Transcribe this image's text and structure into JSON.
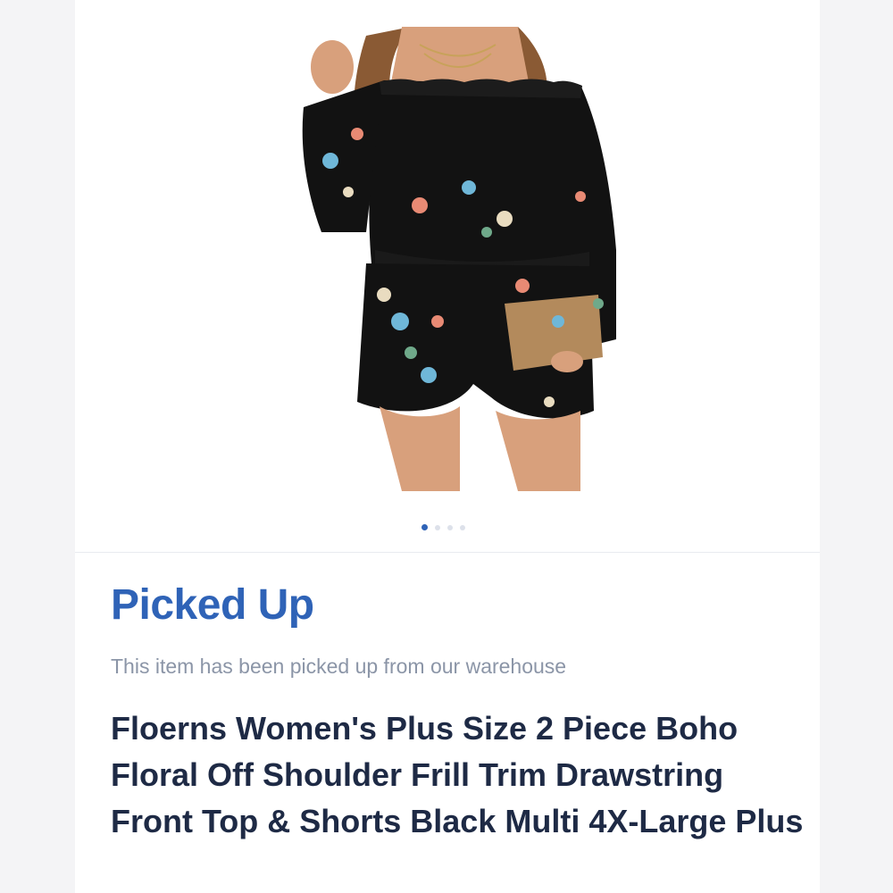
{
  "gallery": {
    "image_alt": "Woman wearing black floral off-shoulder top and shorts set",
    "dots": [
      {
        "active": true
      },
      {
        "active": false
      },
      {
        "active": false
      },
      {
        "active": false
      }
    ]
  },
  "status": {
    "title": "Picked Up",
    "subtitle": "This item has been picked up from our warehouse"
  },
  "product": {
    "title": "Floerns Women's Plus Size 2 Piece Boho Floral Off Shoulder Frill Trim Drawstring Front Top & Shorts Black Multi 4X-Large Plus"
  },
  "colors": {
    "accent": "#2f63b7",
    "title_text": "#1e2a45",
    "muted_text": "#8b95a7"
  }
}
